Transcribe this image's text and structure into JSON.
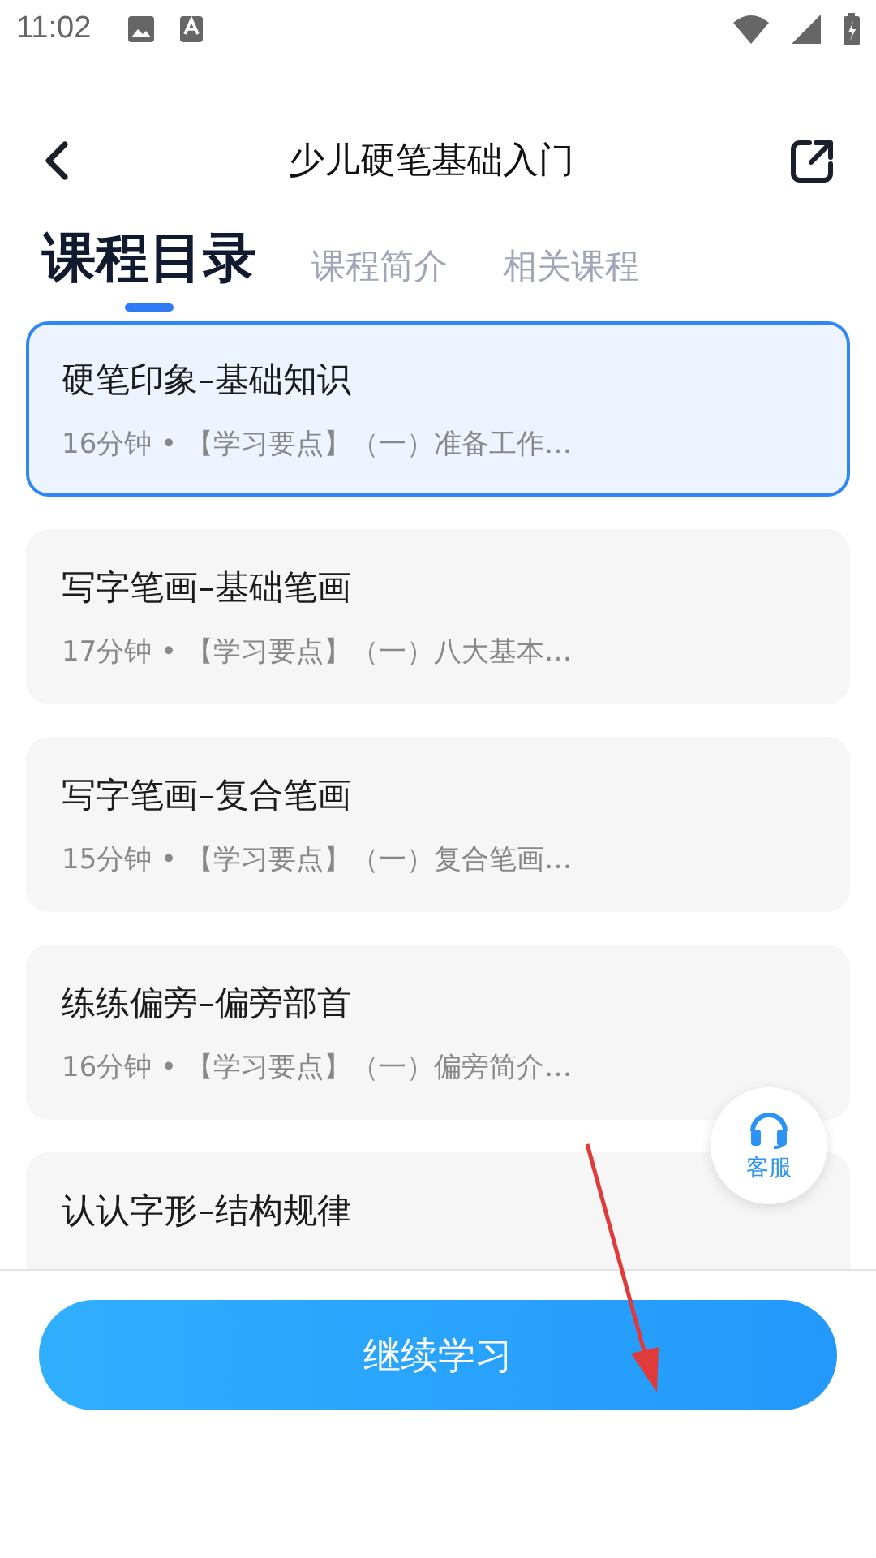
{
  "status_bar": {
    "time": "11:02"
  },
  "header": {
    "title": "少儿硬笔基础入门"
  },
  "tabs": [
    {
      "label": "课程目录",
      "selected": true
    },
    {
      "label": "课程简介",
      "selected": false
    },
    {
      "label": "相关课程",
      "selected": false
    }
  ],
  "lessons": [
    {
      "title": "硬笔印象–基础知识",
      "meta": "16分钟 • 【学习要点】（一）准备工作…",
      "selected": true
    },
    {
      "title": "写字笔画–基础笔画",
      "meta": "17分钟 • 【学习要点】（一）八大基本…",
      "selected": false
    },
    {
      "title": "写字笔画–复合笔画",
      "meta": "15分钟 • 【学习要点】（一）复合笔画…",
      "selected": false
    },
    {
      "title": "练练偏旁–偏旁部首",
      "meta": "16分钟 • 【学习要点】（一）偏旁简介…",
      "selected": false
    },
    {
      "title": "认认字形–结构规律",
      "selected": false
    }
  ],
  "support_button": {
    "label": "客服"
  },
  "continue_button": {
    "label": "继续学习"
  }
}
